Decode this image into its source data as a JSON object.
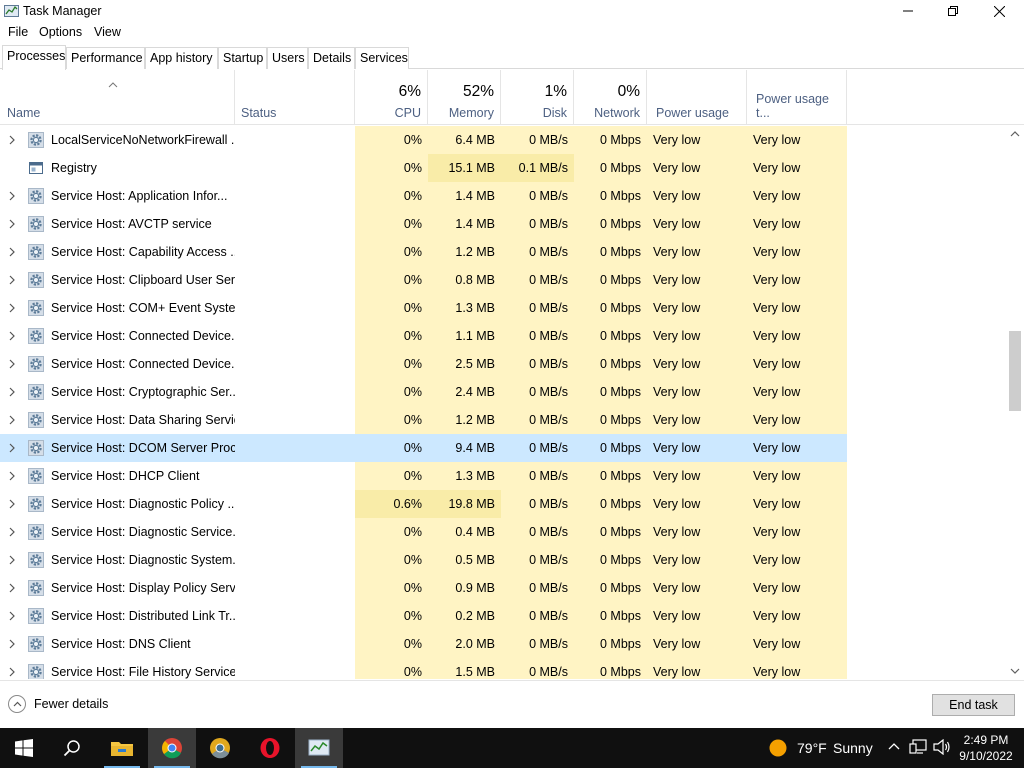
{
  "window": {
    "title": "Task Manager"
  },
  "menu": [
    "File",
    "Options",
    "View"
  ],
  "tabs": [
    "Processes",
    "Performance",
    "App history",
    "Startup",
    "Users",
    "Details",
    "Services"
  ],
  "columns": {
    "name": "Name",
    "status": "Status",
    "cpu": {
      "pct": "6%",
      "label": "CPU"
    },
    "memory": {
      "pct": "52%",
      "label": "Memory"
    },
    "disk": {
      "pct": "1%",
      "label": "Disk"
    },
    "network": {
      "pct": "0%",
      "label": "Network"
    },
    "power": "Power usage",
    "power_trend": "Power usage t..."
  },
  "rows": [
    {
      "name": "LocalServiceNoNetworkFirewall ...",
      "cpu": "0%",
      "memory": "6.4 MB",
      "disk": "0 MB/s",
      "network": "0 Mbps",
      "power": "Very low",
      "power_trend": "Very low",
      "expandable": true,
      "icon": "gear-icon"
    },
    {
      "name": "Registry",
      "cpu": "0%",
      "memory": "15.1 MB",
      "disk": "0.1 MB/s",
      "network": "0 Mbps",
      "power": "Very low",
      "power_trend": "Very low",
      "expandable": false,
      "icon": "window-icon"
    },
    {
      "name": "Service Host: Application Infor...",
      "cpu": "0%",
      "memory": "1.4 MB",
      "disk": "0 MB/s",
      "network": "0 Mbps",
      "power": "Very low",
      "power_trend": "Very low",
      "expandable": true,
      "icon": "gear-icon"
    },
    {
      "name": "Service Host: AVCTP service",
      "cpu": "0%",
      "memory": "1.4 MB",
      "disk": "0 MB/s",
      "network": "0 Mbps",
      "power": "Very low",
      "power_trend": "Very low",
      "expandable": true,
      "icon": "gear-icon"
    },
    {
      "name": "Service Host: Capability Access ...",
      "cpu": "0%",
      "memory": "1.2 MB",
      "disk": "0 MB/s",
      "network": "0 Mbps",
      "power": "Very low",
      "power_trend": "Very low",
      "expandable": true,
      "icon": "gear-icon"
    },
    {
      "name": "Service Host: Clipboard User Ser...",
      "cpu": "0%",
      "memory": "0.8 MB",
      "disk": "0 MB/s",
      "network": "0 Mbps",
      "power": "Very low",
      "power_trend": "Very low",
      "expandable": true,
      "icon": "gear-icon"
    },
    {
      "name": "Service Host: COM+ Event Syste...",
      "cpu": "0%",
      "memory": "1.3 MB",
      "disk": "0 MB/s",
      "network": "0 Mbps",
      "power": "Very low",
      "power_trend": "Very low",
      "expandable": true,
      "icon": "gear-icon"
    },
    {
      "name": "Service Host: Connected Device...",
      "cpu": "0%",
      "memory": "1.1 MB",
      "disk": "0 MB/s",
      "network": "0 Mbps",
      "power": "Very low",
      "power_trend": "Very low",
      "expandable": true,
      "icon": "gear-icon"
    },
    {
      "name": "Service Host: Connected Device...",
      "cpu": "0%",
      "memory": "2.5 MB",
      "disk": "0 MB/s",
      "network": "0 Mbps",
      "power": "Very low",
      "power_trend": "Very low",
      "expandable": true,
      "icon": "gear-icon"
    },
    {
      "name": "Service Host: Cryptographic Ser...",
      "cpu": "0%",
      "memory": "2.4 MB",
      "disk": "0 MB/s",
      "network": "0 Mbps",
      "power": "Very low",
      "power_trend": "Very low",
      "expandable": true,
      "icon": "gear-icon"
    },
    {
      "name": "Service Host: Data Sharing Service",
      "cpu": "0%",
      "memory": "1.2 MB",
      "disk": "0 MB/s",
      "network": "0 Mbps",
      "power": "Very low",
      "power_trend": "Very low",
      "expandable": true,
      "icon": "gear-icon"
    },
    {
      "name": "Service Host: DCOM Server Proc...",
      "cpu": "0%",
      "memory": "9.4 MB",
      "disk": "0 MB/s",
      "network": "0 Mbps",
      "power": "Very low",
      "power_trend": "Very low",
      "expandable": true,
      "icon": "gear-icon",
      "selected": true
    },
    {
      "name": "Service Host: DHCP Client",
      "cpu": "0%",
      "memory": "1.3 MB",
      "disk": "0 MB/s",
      "network": "0 Mbps",
      "power": "Very low",
      "power_trend": "Very low",
      "expandable": true,
      "icon": "gear-icon"
    },
    {
      "name": "Service Host: Diagnostic Policy ...",
      "cpu": "0.6%",
      "memory": "19.8 MB",
      "disk": "0 MB/s",
      "network": "0 Mbps",
      "power": "Very low",
      "power_trend": "Very low",
      "expandable": true,
      "icon": "gear-icon"
    },
    {
      "name": "Service Host: Diagnostic Service...",
      "cpu": "0%",
      "memory": "0.4 MB",
      "disk": "0 MB/s",
      "network": "0 Mbps",
      "power": "Very low",
      "power_trend": "Very low",
      "expandable": true,
      "icon": "gear-icon"
    },
    {
      "name": "Service Host: Diagnostic System...",
      "cpu": "0%",
      "memory": "0.5 MB",
      "disk": "0 MB/s",
      "network": "0 Mbps",
      "power": "Very low",
      "power_trend": "Very low",
      "expandable": true,
      "icon": "gear-icon"
    },
    {
      "name": "Service Host: Display Policy Serv...",
      "cpu": "0%",
      "memory": "0.9 MB",
      "disk": "0 MB/s",
      "network": "0 Mbps",
      "power": "Very low",
      "power_trend": "Very low",
      "expandable": true,
      "icon": "gear-icon"
    },
    {
      "name": "Service Host: Distributed Link Tr...",
      "cpu": "0%",
      "memory": "0.2 MB",
      "disk": "0 MB/s",
      "network": "0 Mbps",
      "power": "Very low",
      "power_trend": "Very low",
      "expandable": true,
      "icon": "gear-icon"
    },
    {
      "name": "Service Host: DNS Client",
      "cpu": "0%",
      "memory": "2.0 MB",
      "disk": "0 MB/s",
      "network": "0 Mbps",
      "power": "Very low",
      "power_trend": "Very low",
      "expandable": true,
      "icon": "gear-icon"
    },
    {
      "name": "Service Host: File History Service",
      "cpu": "0%",
      "memory": "1.5 MB",
      "disk": "0 MB/s",
      "network": "0 Mbps",
      "power": "Very low",
      "power_trend": "Very low",
      "expandable": true,
      "icon": "gear-icon"
    }
  ],
  "footer": {
    "fewer_details": "Fewer details",
    "end_task": "End task"
  },
  "taskbar": {
    "apps": [
      "start-icon",
      "search-icon",
      "file-explorer-icon",
      "chrome-icon",
      "chrome-canary-icon",
      "opera-icon",
      "task-manager-icon"
    ],
    "weather": {
      "temp": "79°F",
      "condition": "Sunny"
    },
    "time": "2:49 PM",
    "date": "9/10/2022"
  },
  "colors": {
    "heat_light": "#fff4c4",
    "heat_medium": "#f9eca8",
    "selected_row": "#cce8ff",
    "header_label": "#4d6082",
    "taskbar": "#101010"
  }
}
